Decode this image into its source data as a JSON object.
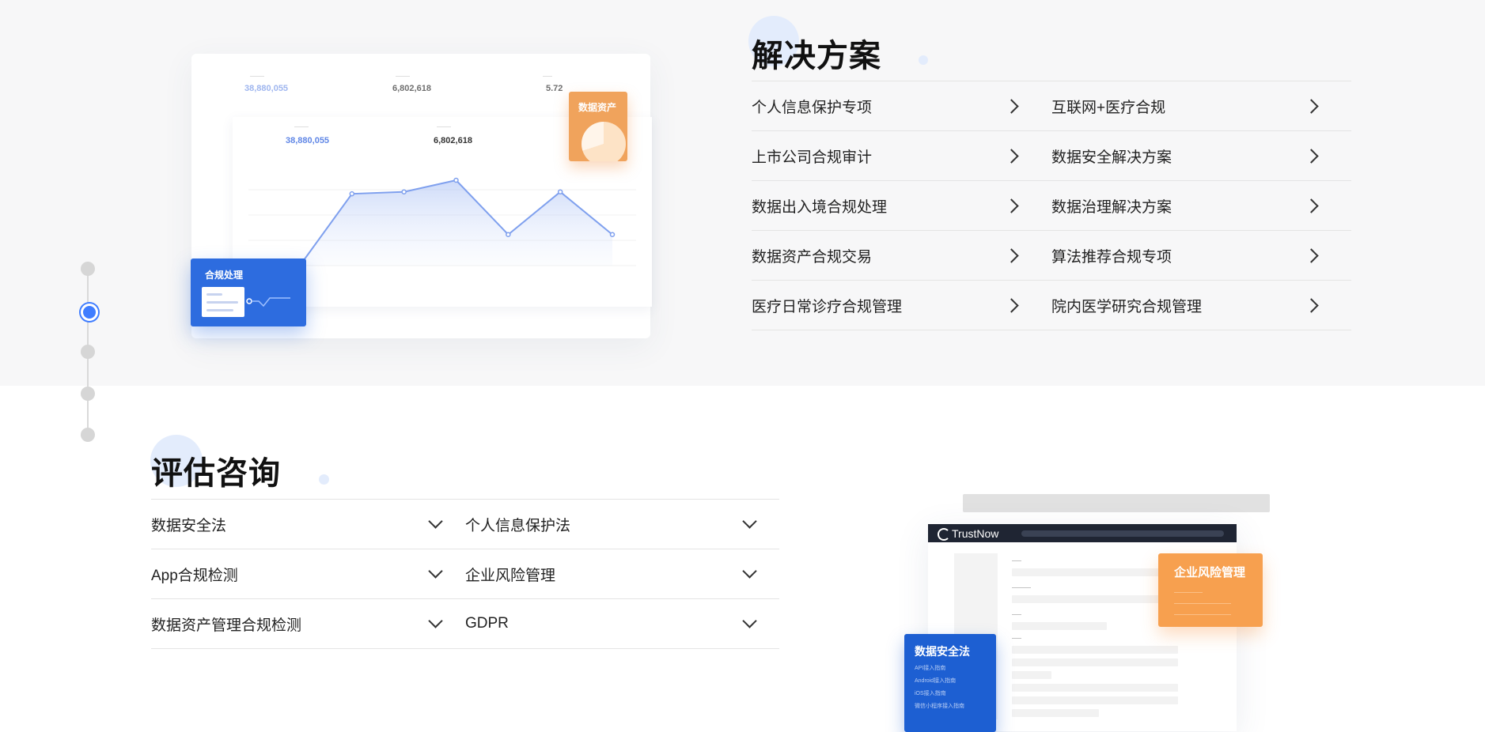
{
  "colors": {
    "accent_blue": "#3f7dff",
    "badge_blue": "#2d6cdf",
    "badge_orange": "#f0a35c",
    "page_band": "#f7f7f8"
  },
  "step_nav": {
    "count": 5,
    "active_index": 1
  },
  "solutions": {
    "title": "解决方案",
    "items": [
      "个人信息保护专项",
      "互联网+医疗合规",
      "上市公司合规审计",
      "数据安全解决方案",
      "数据出入境合规处理",
      "数据治理解决方案",
      "数据资产合规交易",
      "算法推荐合规专项",
      "医疗日常诊疗合规管理",
      "院内医学研究合规管理"
    ],
    "chevron_icon": "chevron-right-icon"
  },
  "evaluation": {
    "title": "评估咨询",
    "items": [
      "数据安全法",
      "个人信息保护法",
      "App合规检测",
      "企业风险管理",
      "数据资产管理合规检测",
      "GDPR"
    ],
    "chevron_icon": "chevron-down-icon"
  },
  "illustration_dashboard": {
    "stats_top": [
      "38,880,055",
      "6,802,618",
      "5.72"
    ],
    "stats_inner": [
      "38,880,055",
      "6,802,618"
    ],
    "badge_data_asset": "数据资产",
    "badge_compliance": "合规处理"
  },
  "chart_data": {
    "type": "area",
    "title": "",
    "xlabel": "",
    "ylabel": "",
    "series": [
      {
        "values": [
          1,
          38,
          39,
          45,
          17,
          39,
          17
        ]
      }
    ]
  },
  "illustration_product": {
    "logo": "TrustNow",
    "badge_risk": "企业风险管理",
    "badge_law": "数据安全法",
    "badge_law_lines": [
      "API接入指南",
      "Android接入指南",
      "iOS接入指南",
      "微信小程序接入指南"
    ]
  }
}
